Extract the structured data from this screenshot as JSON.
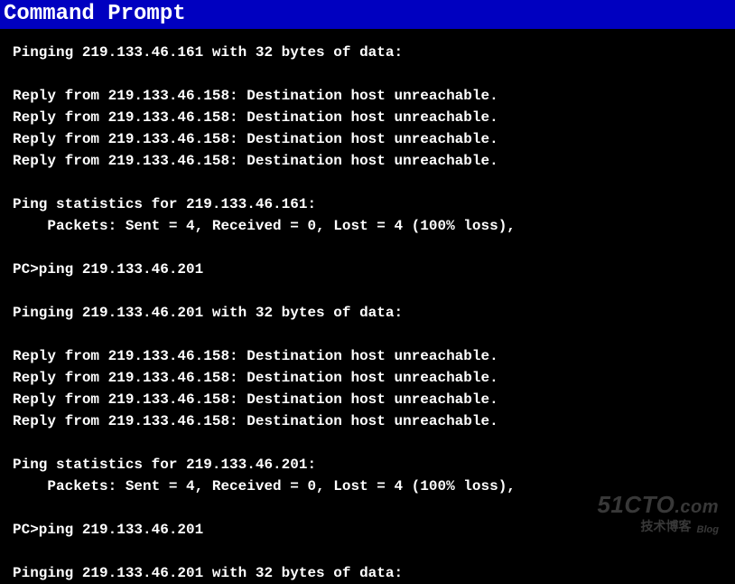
{
  "window": {
    "title": "Command Prompt"
  },
  "terminal": {
    "lines": [
      "Pinging 219.133.46.161 with 32 bytes of data:",
      "",
      "Reply from 219.133.46.158: Destination host unreachable.",
      "Reply from 219.133.46.158: Destination host unreachable.",
      "Reply from 219.133.46.158: Destination host unreachable.",
      "Reply from 219.133.46.158: Destination host unreachable.",
      "",
      "Ping statistics for 219.133.46.161:",
      "    Packets: Sent = 4, Received = 0, Lost = 4 (100% loss),",
      "",
      "PC>ping 219.133.46.201",
      "",
      "Pinging 219.133.46.201 with 32 bytes of data:",
      "",
      "Reply from 219.133.46.158: Destination host unreachable.",
      "Reply from 219.133.46.158: Destination host unreachable.",
      "Reply from 219.133.46.158: Destination host unreachable.",
      "Reply from 219.133.46.158: Destination host unreachable.",
      "",
      "Ping statistics for 219.133.46.201:",
      "    Packets: Sent = 4, Received = 0, Lost = 4 (100% loss),",
      "",
      "PC>ping 219.133.46.201",
      "",
      "Pinging 219.133.46.201 with 32 bytes of data:"
    ]
  },
  "watermark": {
    "brand": "51CTO",
    "suffix": ".com",
    "sub": "技术博客",
    "blog": "Blog"
  }
}
